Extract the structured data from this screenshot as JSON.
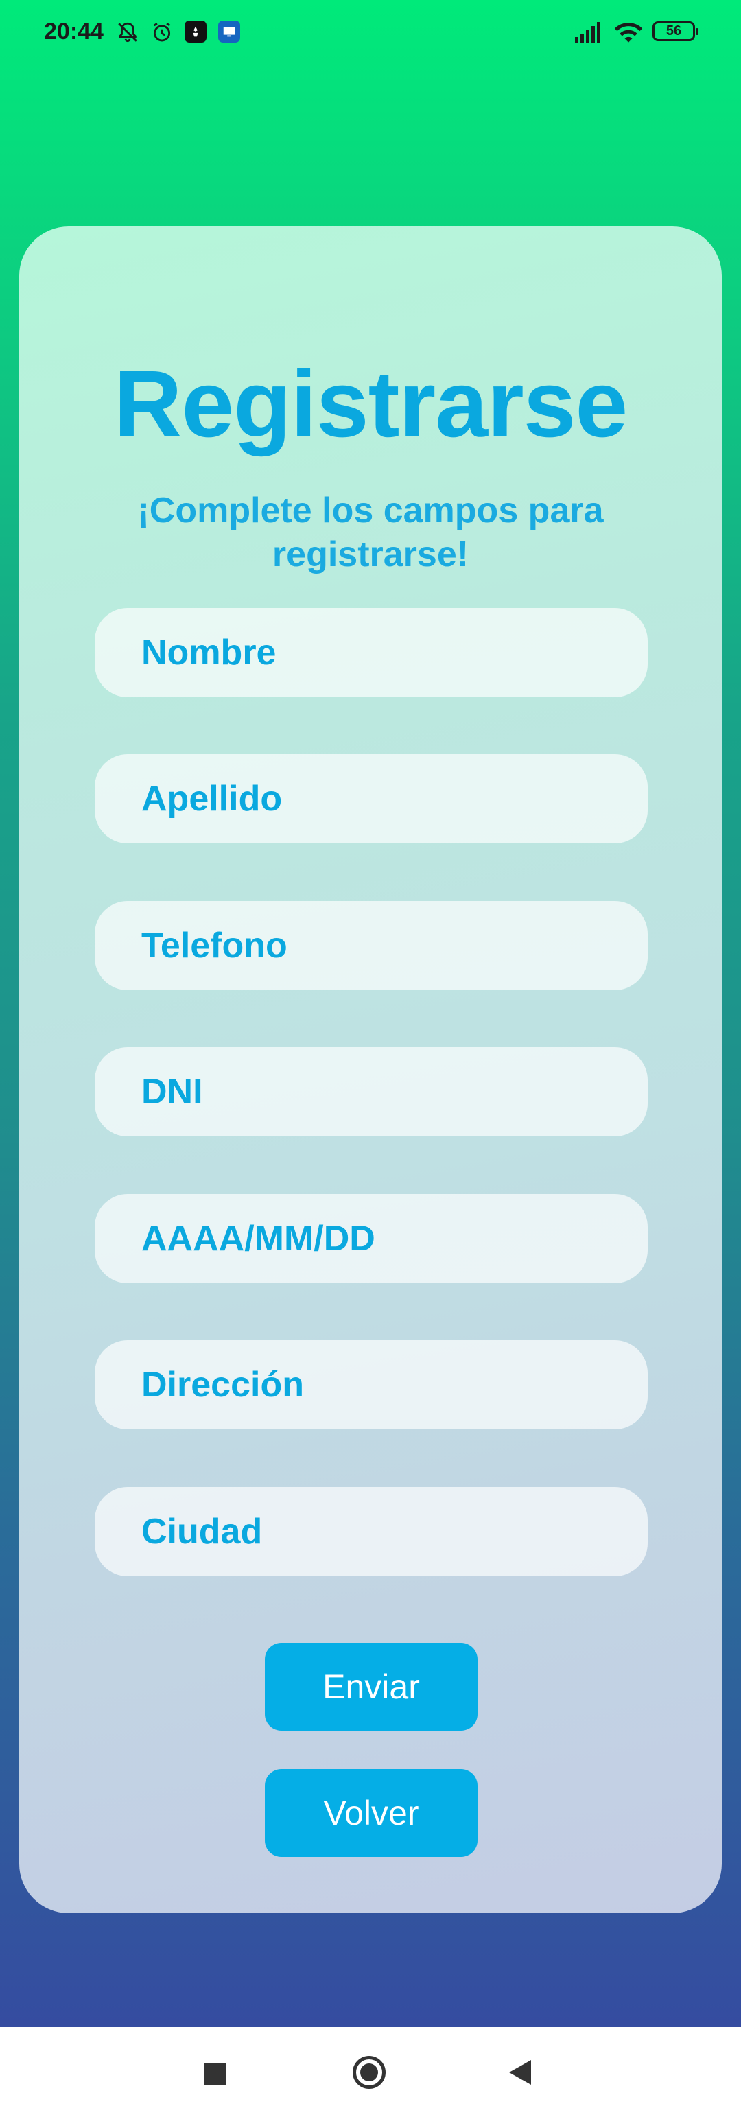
{
  "status_bar": {
    "time": "20:44",
    "battery": "56"
  },
  "form": {
    "title": "Registrarse",
    "subtitle": "¡Complete los campos para registrarse!",
    "fields": [
      {
        "placeholder": "Nombre"
      },
      {
        "placeholder": "Apellido"
      },
      {
        "placeholder": "Telefono"
      },
      {
        "placeholder": "DNI"
      },
      {
        "placeholder": "AAAA/MM/DD"
      },
      {
        "placeholder": "Dirección"
      },
      {
        "placeholder": "Ciudad"
      }
    ],
    "submit_label": "Enviar",
    "back_label": "Volver"
  },
  "colors": {
    "accent": "#0aa8df",
    "button": "#05aee6",
    "gradient_top": "#00ea7a",
    "gradient_bottom": "#354ca0"
  },
  "icons": [
    "bell-off-icon",
    "alarm-icon",
    "app-notification-icon",
    "screen-share-icon",
    "signal-icon",
    "wifi-icon",
    "battery-icon",
    "nav-recents-icon",
    "nav-home-icon",
    "nav-back-icon"
  ]
}
